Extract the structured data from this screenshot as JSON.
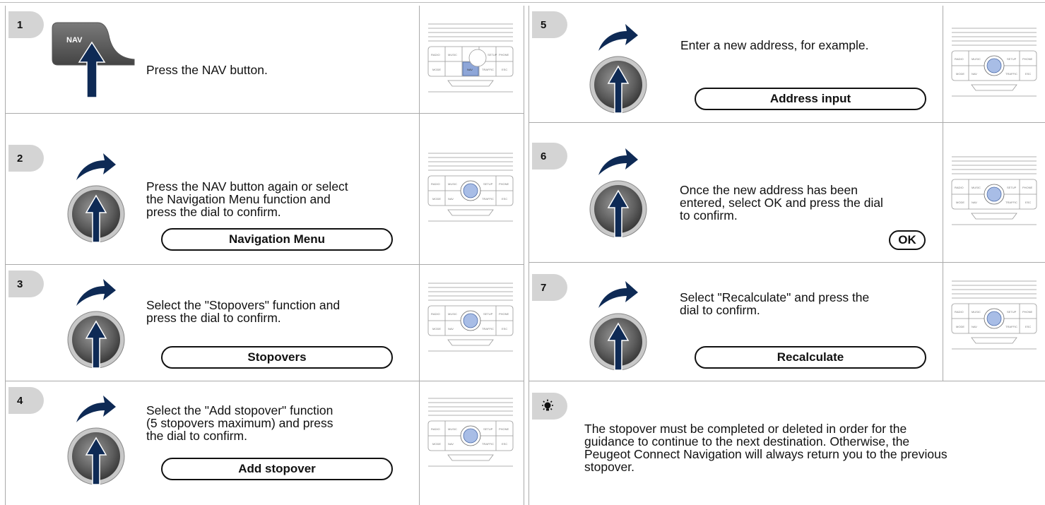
{
  "colors": {
    "badge_bg": "#d4d4d4",
    "arrow_navy": "#0e2a55",
    "dial_grey": "#6a6a6a",
    "border": "#aaaaaa"
  },
  "panel": {
    "row1": [
      "RADIO",
      "MUSIC",
      "SETUP",
      "PHONE"
    ],
    "row2": [
      "MODE",
      "NAV",
      "TRAFFIC",
      "ESC"
    ]
  },
  "steps": [
    {
      "number": "1",
      "text": "Press the NAV button.",
      "icon": "nav-key-press-icon",
      "key_label": "NAV"
    },
    {
      "number": "2",
      "text_lines": [
        "Press the NAV button again or select",
        "the Navigation Menu function and",
        "press the dial to confirm."
      ],
      "button": "Navigation Menu",
      "icon": "dial-turn-press-icon"
    },
    {
      "number": "3",
      "text_lines": [
        "Select the \"Stopovers\" function and",
        "press the dial to confirm."
      ],
      "button": "Stopovers",
      "icon": "dial-turn-press-icon"
    },
    {
      "number": "4",
      "text_lines": [
        "Select the \"Add stopover\" function",
        "(5 stopovers maximum) and press",
        "the dial to confirm."
      ],
      "button": "Add stopover",
      "icon": "dial-turn-press-icon"
    },
    {
      "number": "5",
      "text": "Enter a new address, for example.",
      "button": "Address input",
      "icon": "dial-turn-press-icon"
    },
    {
      "number": "6",
      "text_lines": [
        "Once the new address has been",
        "entered, select OK and press the dial",
        "to confirm."
      ],
      "button": "OK",
      "icon": "dial-turn-press-icon"
    },
    {
      "number": "7",
      "text_lines": [
        "Select \"Recalculate\" and press the",
        "dial to confirm."
      ],
      "button": "Recalculate",
      "icon": "dial-turn-press-icon"
    }
  ],
  "tip": {
    "icon": "lightbulb-icon",
    "lines": [
      "The stopover must be completed or deleted in order for the",
      "guidance to continue to the next destination. Otherwise, the",
      "Peugeot Connect Navigation will always return you to the previous",
      "stopover."
    ]
  }
}
